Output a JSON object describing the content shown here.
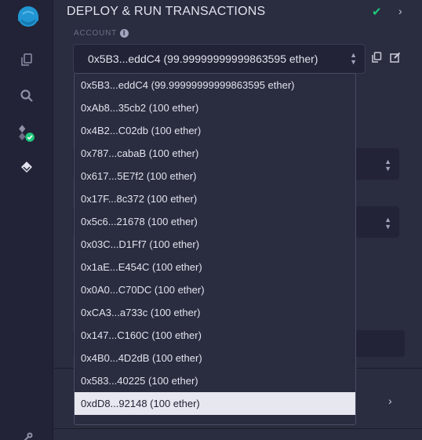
{
  "panel": {
    "title": "DEPLOY & RUN TRANSACTIONS",
    "account_label": "ACCOUNT",
    "info_glyph": "i"
  },
  "account": {
    "selected_value": "0x5B3...eddC4 (99.99999999999863595 ether)"
  },
  "dropdown": {
    "options": [
      "0x5B3...eddC4 (99.99999999999863595 ether)",
      "0xAb8...35cb2 (100 ether)",
      "0x4B2...C02db (100 ether)",
      "0x787...cabaB (100 ether)",
      "0x617...5E7f2 (100 ether)",
      "0x17F...8c372 (100 ether)",
      "0x5c6...21678 (100 ether)",
      "0x03C...D1Ff7 (100 ether)",
      "0x1aE...E454C (100 ether)",
      "0x0A0...C70DC (100 ether)",
      "0xCA3...a733c (100 ether)",
      "0x147...C160C (100 ether)",
      "0x4B0...4D2dB (100 ether)",
      "0x583...40225 (100 ether)",
      "0xdD8...92148 (100 ether)"
    ],
    "highlighted_option": "0xdD8...92148 (100 ether)"
  },
  "icons": {
    "rail": [
      "remix-logo-icon",
      "file-explorer-icon",
      "search-icon",
      "solidity-compiler-icon",
      "deploy-run-icon",
      "settings-icon"
    ],
    "header": [
      "check-icon",
      "chevron-right-icon"
    ],
    "account": [
      "copy-icon",
      "edit-icon"
    ]
  },
  "colors": {
    "accent_blue": "#2196d3",
    "success_green": "#1ec97d",
    "highlight_bg": "#e6e7ef"
  }
}
